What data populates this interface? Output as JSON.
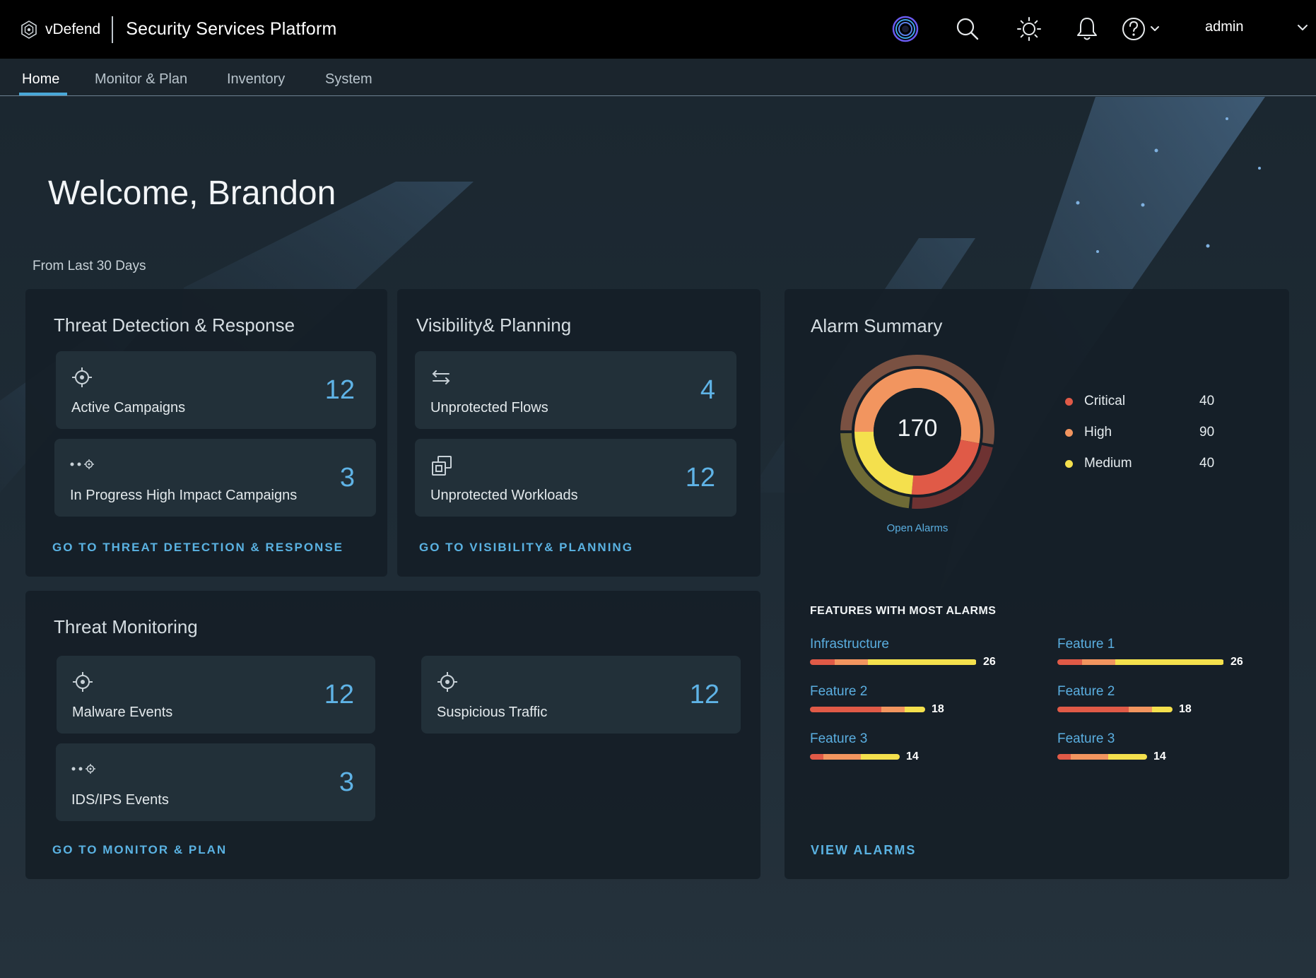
{
  "header": {
    "brand": "vDefend",
    "app_title": "Security Services Platform",
    "icons": [
      "ai-assistant-icon",
      "search-icon",
      "theme-sun-icon",
      "bell-icon",
      "help-icon"
    ],
    "user": "admin"
  },
  "nav": {
    "tabs": [
      {
        "label": "Home",
        "active": true
      },
      {
        "label": "Monitor & Plan",
        "active": false
      },
      {
        "label": "Inventory",
        "active": false
      },
      {
        "label": "System",
        "active": false
      }
    ]
  },
  "welcome": "Welcome, Brandon",
  "range_label": "From Last 30 Days",
  "threat_detection": {
    "title": "Threat Detection & Response",
    "tiles": [
      {
        "label": "Active Campaigns",
        "value": "12",
        "icon": "target-icon"
      },
      {
        "label": "In Progress High Impact Campaigns",
        "value": "3",
        "icon": "progress-target-icon"
      }
    ],
    "link": "GO TO THREAT DETECTION & RESPONSE"
  },
  "visibility": {
    "title": "Visibility& Planning",
    "tiles": [
      {
        "label": "Unprotected Flows",
        "value": "4",
        "icon": "flows-icon"
      },
      {
        "label": "Unprotected Workloads",
        "value": "12",
        "icon": "workloads-icon"
      }
    ],
    "link": "GO TO VISIBILITY& PLANNING"
  },
  "threat_monitoring": {
    "title": "Threat Monitoring",
    "tiles": [
      {
        "label": "Malware Events",
        "value": "12",
        "icon": "target-icon"
      },
      {
        "label": "Suspicious Traffic",
        "value": "12",
        "icon": "target-icon"
      },
      {
        "label": "IDS/IPS Events",
        "value": "3",
        "icon": "progress-target-icon"
      }
    ],
    "link": "GO TO MONITOR & PLAN"
  },
  "alarm_summary": {
    "title": "Alarm Summary",
    "total": "170",
    "donut_caption": "Open Alarms",
    "legend": [
      {
        "label": "Critical",
        "value": "40",
        "color": "#e05a47"
      },
      {
        "label": "High",
        "value": "90",
        "color": "#f2955f"
      },
      {
        "label": "Medium",
        "value": "40",
        "color": "#f4e04d"
      }
    ],
    "features_title": "FEATURES WITH MOST ALARMS",
    "features_left": [
      {
        "name": "Infrastructure",
        "count": "26",
        "value": 26
      },
      {
        "name": "Feature 2",
        "count": "18",
        "value": 18
      },
      {
        "name": "Feature 3",
        "count": "14",
        "value": 14
      }
    ],
    "features_right": [
      {
        "name": "Feature 1",
        "count": "26",
        "value": 26
      },
      {
        "name": "Feature 2",
        "count": "18",
        "value": 18
      },
      {
        "name": "Feature 3",
        "count": "14",
        "value": 14
      }
    ],
    "link": "VIEW ALARMS"
  },
  "colors": {
    "accent": "#5ab2e2",
    "critical": "#e05a47",
    "high": "#f2955f",
    "medium": "#f4e04d"
  }
}
